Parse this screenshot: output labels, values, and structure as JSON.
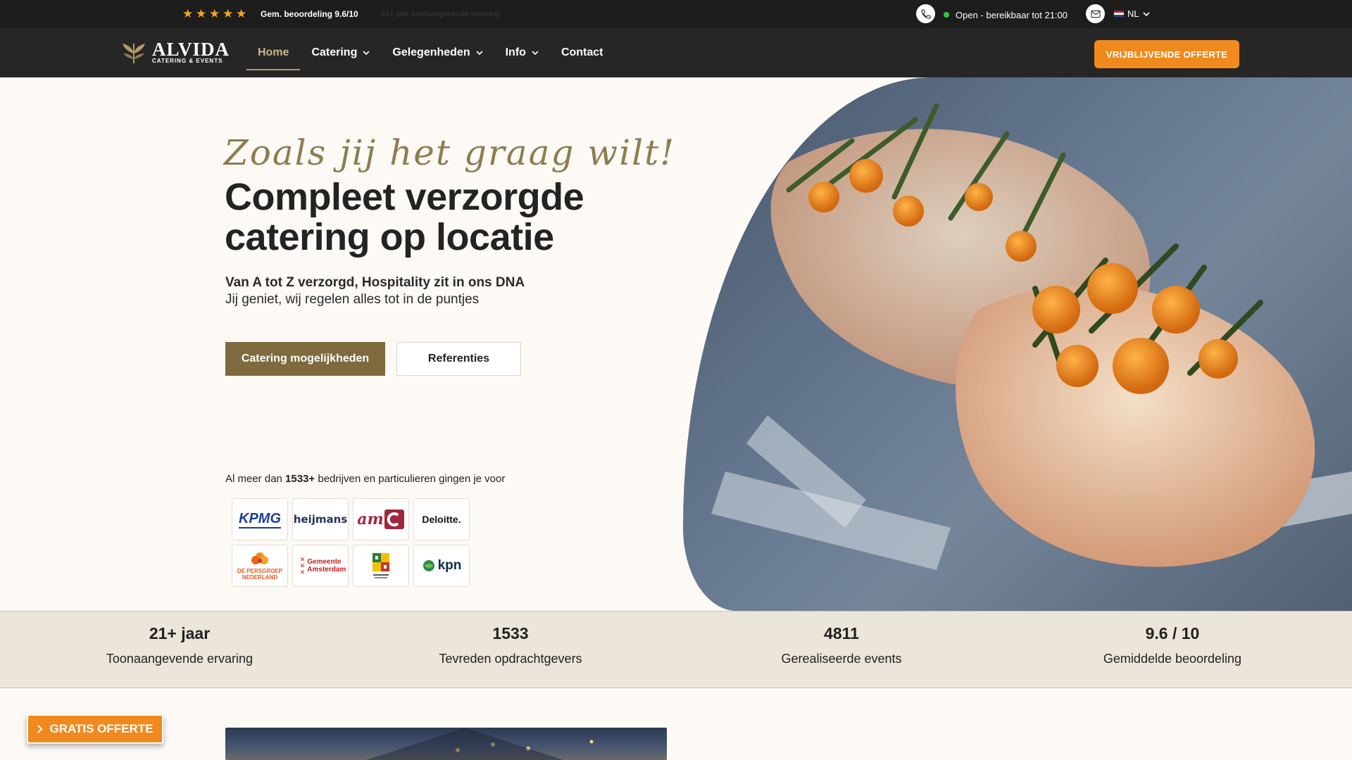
{
  "topbar": {
    "rating_text": "Gem. beoordeling 9.6/10",
    "experience_note": "21+ jaar toonaangevende ervaring",
    "open_status": "Open - bereikbaar tot 21:00",
    "language": "NL",
    "star_count": 5
  },
  "nav": {
    "logo_name": "ALVIDA",
    "logo_sub": "CATERING & EVENTS",
    "items": [
      {
        "label": "Home",
        "active": true
      },
      {
        "label": "Catering",
        "dropdown": true
      },
      {
        "label": "Gelegenheden",
        "dropdown": true
      },
      {
        "label": "Info",
        "dropdown": true
      },
      {
        "label": "Contact"
      }
    ],
    "cta": "VRIJBLIJVENDE OFFERTE"
  },
  "hero": {
    "script": "Zoals jij het graag wilt!",
    "headline_1": "Compleet verzorgde",
    "headline_2": "catering op locatie",
    "sub_bold": "Van A tot Z verzorgd, Hospitality zit in ons DNA",
    "sub_regular": "Jij geniet, wij regelen alles tot in de puntjes",
    "btn_primary": "Catering mogelijkheden",
    "btn_secondary": "Referenties",
    "clients_prefix": "Al meer dan ",
    "clients_count": "1533+",
    "clients_suffix": " bedrijven en particulieren gingen je voor"
  },
  "client_logos": [
    {
      "name": "KPMG",
      "text": "KPMG"
    },
    {
      "name": "Heijmans",
      "text": "heijmans"
    },
    {
      "name": "AMC",
      "text": "am"
    },
    {
      "name": "Deloitte",
      "text": "Deloitte."
    },
    {
      "name": "De Persgroep",
      "text": "DE PERSGROEP NEDERLAND"
    },
    {
      "name": "Gemeente Amsterdam",
      "text": "Gemeente Amsterdam"
    },
    {
      "name": "Gemeente",
      "text": ""
    },
    {
      "name": "KPN",
      "text": "kpn"
    }
  ],
  "stats": [
    {
      "value": "21+ jaar",
      "label": "Toonaangevende ervaring"
    },
    {
      "value": "1533",
      "label": "Tevreden opdrachtgevers"
    },
    {
      "value": "4811",
      "label": "Gerealiseerde events"
    },
    {
      "value": "9.6 / 10",
      "label": "Gemiddelde beoordeling"
    }
  ],
  "floating_cta": "GRATIS OFFERTE",
  "colors": {
    "accent_orange": "#f08a1e",
    "brand_gold": "#7e6a3c",
    "topbar_bg": "#1d1d1d",
    "nav_bg": "#262626"
  }
}
